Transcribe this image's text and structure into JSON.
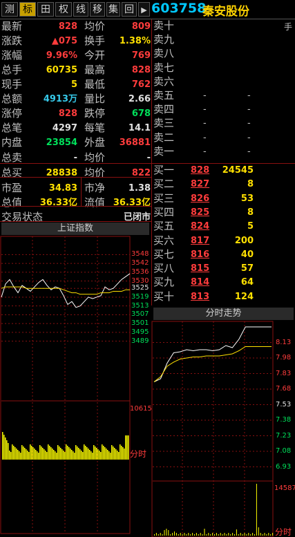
{
  "toolbar": {
    "buttons": [
      "测",
      "标",
      "田",
      "权",
      "线",
      "移",
      "集",
      "回",
      "▶"
    ],
    "stock_code": "603758",
    "stock_name": "秦安股份",
    "corner": "手"
  },
  "quote": {
    "left": [
      {
        "label": "最新",
        "value": "828",
        "color": "red"
      },
      {
        "label": "涨跌",
        "value": "▲075",
        "color": "red"
      },
      {
        "label": "涨幅",
        "value": "9.96%",
        "color": "red"
      },
      {
        "label": "总手",
        "value": "60735",
        "color": "yellow"
      },
      {
        "label": "现手",
        "value": "5",
        "color": "yellow"
      },
      {
        "label": "总额",
        "value": "4913万",
        "color": "cyan"
      },
      {
        "label": "涨停",
        "value": "828",
        "color": "red"
      },
      {
        "label": "总笔",
        "value": "4297",
        "color": "white"
      },
      {
        "label": "内盘",
        "value": "23854",
        "color": "green"
      },
      {
        "label": "总卖",
        "value": "-",
        "color": "white"
      },
      {
        "label": "总买",
        "value": "28838",
        "color": "yellow"
      },
      {
        "label": "市盈",
        "value": "34.83",
        "color": "yellow"
      },
      {
        "label": "总值",
        "value": "36.33亿",
        "color": "yellow"
      },
      {
        "label": "交易状态",
        "value": "",
        "color": "white"
      }
    ],
    "right": [
      {
        "label": "均价",
        "value": "809",
        "color": "red"
      },
      {
        "label": "换手",
        "value": "1.38%",
        "color": "yellow"
      },
      {
        "label": "今开",
        "value": "769",
        "color": "red"
      },
      {
        "label": "最高",
        "value": "828",
        "color": "red"
      },
      {
        "label": "最低",
        "value": "762",
        "color": "red"
      },
      {
        "label": "量比",
        "value": "2.66",
        "color": "white"
      },
      {
        "label": "跌停",
        "value": "678",
        "color": "green"
      },
      {
        "label": "每笔",
        "value": "14.1",
        "color": "white"
      },
      {
        "label": "外盘",
        "value": "36881",
        "color": "red"
      },
      {
        "label": "均价",
        "value": "-",
        "color": "white"
      },
      {
        "label": "均价",
        "value": "822",
        "color": "red"
      },
      {
        "label": "市净",
        "value": "1.38",
        "color": "white"
      },
      {
        "label": "流值",
        "value": "36.33亿",
        "color": "yellow"
      },
      {
        "label": "",
        "value": "已闭市",
        "color": "white"
      }
    ]
  },
  "orderbook": {
    "sell": [
      {
        "label": "卖十",
        "price": "",
        "vol": ""
      },
      {
        "label": "卖九",
        "price": "",
        "vol": ""
      },
      {
        "label": "卖八",
        "price": "",
        "vol": ""
      },
      {
        "label": "卖七",
        "price": "",
        "vol": ""
      },
      {
        "label": "卖六",
        "price": "",
        "vol": ""
      },
      {
        "label": "卖五",
        "price": "-",
        "vol": "-"
      },
      {
        "label": "卖四",
        "price": "-",
        "vol": "-"
      },
      {
        "label": "卖三",
        "price": "-",
        "vol": "-"
      },
      {
        "label": "卖二",
        "price": "-",
        "vol": "-"
      },
      {
        "label": "卖一",
        "price": "-",
        "vol": "-"
      }
    ],
    "buy": [
      {
        "label": "买一",
        "price": "828",
        "vol": "24545"
      },
      {
        "label": "买二",
        "price": "827",
        "vol": "8"
      },
      {
        "label": "买三",
        "price": "826",
        "vol": "53"
      },
      {
        "label": "买四",
        "price": "825",
        "vol": "8"
      },
      {
        "label": "买五",
        "price": "824",
        "vol": "5"
      },
      {
        "label": "买六",
        "price": "817",
        "vol": "200"
      },
      {
        "label": "买七",
        "price": "816",
        "vol": "40"
      },
      {
        "label": "买八",
        "price": "815",
        "vol": "57"
      },
      {
        "label": "买九",
        "price": "814",
        "vol": "64"
      },
      {
        "label": "买十",
        "price": "813",
        "vol": "124"
      }
    ]
  },
  "index_panel": {
    "title": "上证指数",
    "price_ticks": [
      "3548",
      "3542",
      "3536",
      "3530",
      "3525",
      "3519",
      "3513",
      "3507",
      "3501",
      "3495",
      "3489"
    ],
    "vol_max": "10615",
    "time_label": "分时"
  },
  "stock_panel": {
    "title": "分时走势",
    "price_ticks": [
      "8.13",
      "7.98",
      "7.83",
      "7.68",
      "7.53",
      "7.38",
      "7.23",
      "7.08",
      "6.93"
    ],
    "vol_max": "14587",
    "time_label": "分时"
  },
  "chart_data": [
    {
      "type": "line",
      "title": "上证指数",
      "ylim": [
        3486,
        3551
      ],
      "series": [
        {
          "values": [
            3519,
            3528,
            3531,
            3526,
            3522,
            3527,
            3525,
            3523,
            3526,
            3529,
            3531,
            3527,
            3524,
            3526,
            3525,
            3520,
            3514,
            3516,
            3512,
            3513,
            3516,
            3519,
            3518,
            3519,
            3520,
            3526,
            3524,
            3525,
            3528,
            3531,
            3533,
            3535
          ]
        },
        {
          "values": [
            3525,
            3526,
            3526,
            3526,
            3526,
            3526,
            3525,
            3525,
            3525,
            3525,
            3525,
            3525,
            3525,
            3525,
            3525,
            3524,
            3523,
            3522,
            3522,
            3521,
            3521,
            3521,
            3521,
            3521,
            3522,
            3522,
            3522,
            3523,
            3523,
            3523,
            3524,
            3524
          ]
        }
      ]
    },
    {
      "type": "line",
      "title": "分时走势",
      "ylim": [
        6.9,
        8.2
      ],
      "series": [
        {
          "values": [
            7.75,
            7.78,
            7.93,
            8.03,
            8.04,
            8.06,
            8.05,
            8.06,
            8.06,
            8.05,
            8.06,
            8.1,
            8.08,
            8.16,
            8.28,
            8.28,
            8.28,
            8.28,
            8.28
          ]
        },
        {
          "values": [
            7.75,
            7.8,
            7.9,
            7.94,
            7.97,
            7.98,
            7.99,
            7.99,
            8.0,
            8.0,
            8.0,
            8.01,
            8.02,
            8.05,
            8.09,
            8.09,
            8.09,
            8.09,
            8.09
          ]
        }
      ]
    }
  ]
}
